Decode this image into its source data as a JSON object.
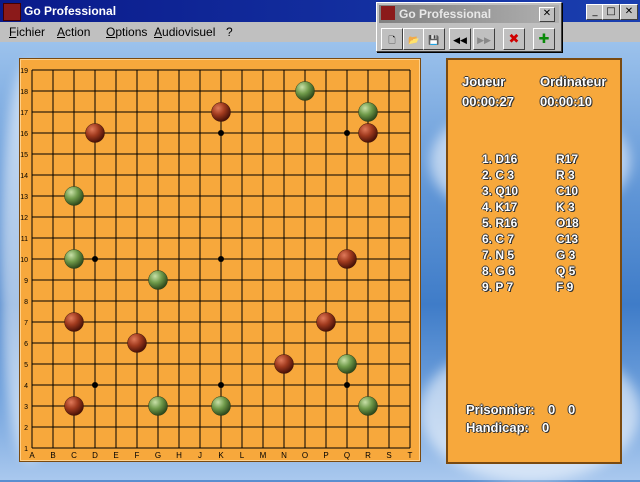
{
  "window": {
    "title": "Go Professional",
    "minimize": "_",
    "maximize": "□",
    "close": "✕"
  },
  "menu": [
    "Fichier",
    "Action",
    "Options",
    "Audiovisuel",
    "?"
  ],
  "toolbar": {
    "title": "Go Professional",
    "close": "✕",
    "buttons": [
      {
        "name": "new-icon",
        "glyph": "🗋"
      },
      {
        "name": "open-folder-icon",
        "glyph": "📂"
      },
      {
        "name": "save-icon",
        "glyph": "💾"
      },
      {
        "name": "rewind-icon",
        "glyph": "◀◀"
      },
      {
        "name": "forward-icon",
        "glyph": "▶▶"
      },
      {
        "name": "stop-icon",
        "glyph": "✖"
      },
      {
        "name": "add-icon",
        "glyph": "✚"
      }
    ]
  },
  "board": {
    "columns": [
      "A",
      "B",
      "C",
      "D",
      "E",
      "F",
      "G",
      "H",
      "J",
      "K",
      "L",
      "M",
      "N",
      "O",
      "P",
      "Q",
      "R",
      "S",
      "T"
    ],
    "rows": [
      "19",
      "18",
      "17",
      "16",
      "15",
      "14",
      "13",
      "12",
      "11",
      "10",
      "9",
      "8",
      "7",
      "6",
      "5",
      "4",
      "3",
      "2",
      "1"
    ],
    "hoshi": [
      "D16",
      "K16",
      "Q16",
      "D10",
      "K10",
      "Q10",
      "D4",
      "K4",
      "Q4"
    ],
    "red_stones": [
      "K17",
      "D16",
      "R16",
      "Q10",
      "C7",
      "P7",
      "F6",
      "N5",
      "C3"
    ],
    "green_stones": [
      "O18",
      "R17",
      "C13",
      "C10",
      "G9",
      "Q5",
      "G3",
      "K3",
      "R3"
    ],
    "colors": {
      "red": "#a03a1e",
      "green": "#6f9a4a",
      "board": "#f7a83c"
    }
  },
  "panel": {
    "player_label": "Joueur",
    "computer_label": "Ordinateur",
    "player_time": "00:00:27",
    "computer_time": "00:00:10",
    "moves": [
      {
        "n": "1. D16",
        "c": "R17"
      },
      {
        "n": "2. C 3",
        "c": "R 3"
      },
      {
        "n": "3. Q10",
        "c": "C10"
      },
      {
        "n": "4. K17",
        "c": "K 3"
      },
      {
        "n": "5. R16",
        "c": "O18"
      },
      {
        "n": "6. C 7",
        "c": "C13"
      },
      {
        "n": "7. N 5",
        "c": "G 3"
      },
      {
        "n": "8. G 6",
        "c": "Q 5"
      },
      {
        "n": "9. P 7",
        "c": "F 9"
      }
    ],
    "prisoners_label": "Prisonnier:",
    "prisoners_player": "0",
    "prisoners_computer": "0",
    "handicap_label": "Handicap:",
    "handicap_value": "0"
  }
}
